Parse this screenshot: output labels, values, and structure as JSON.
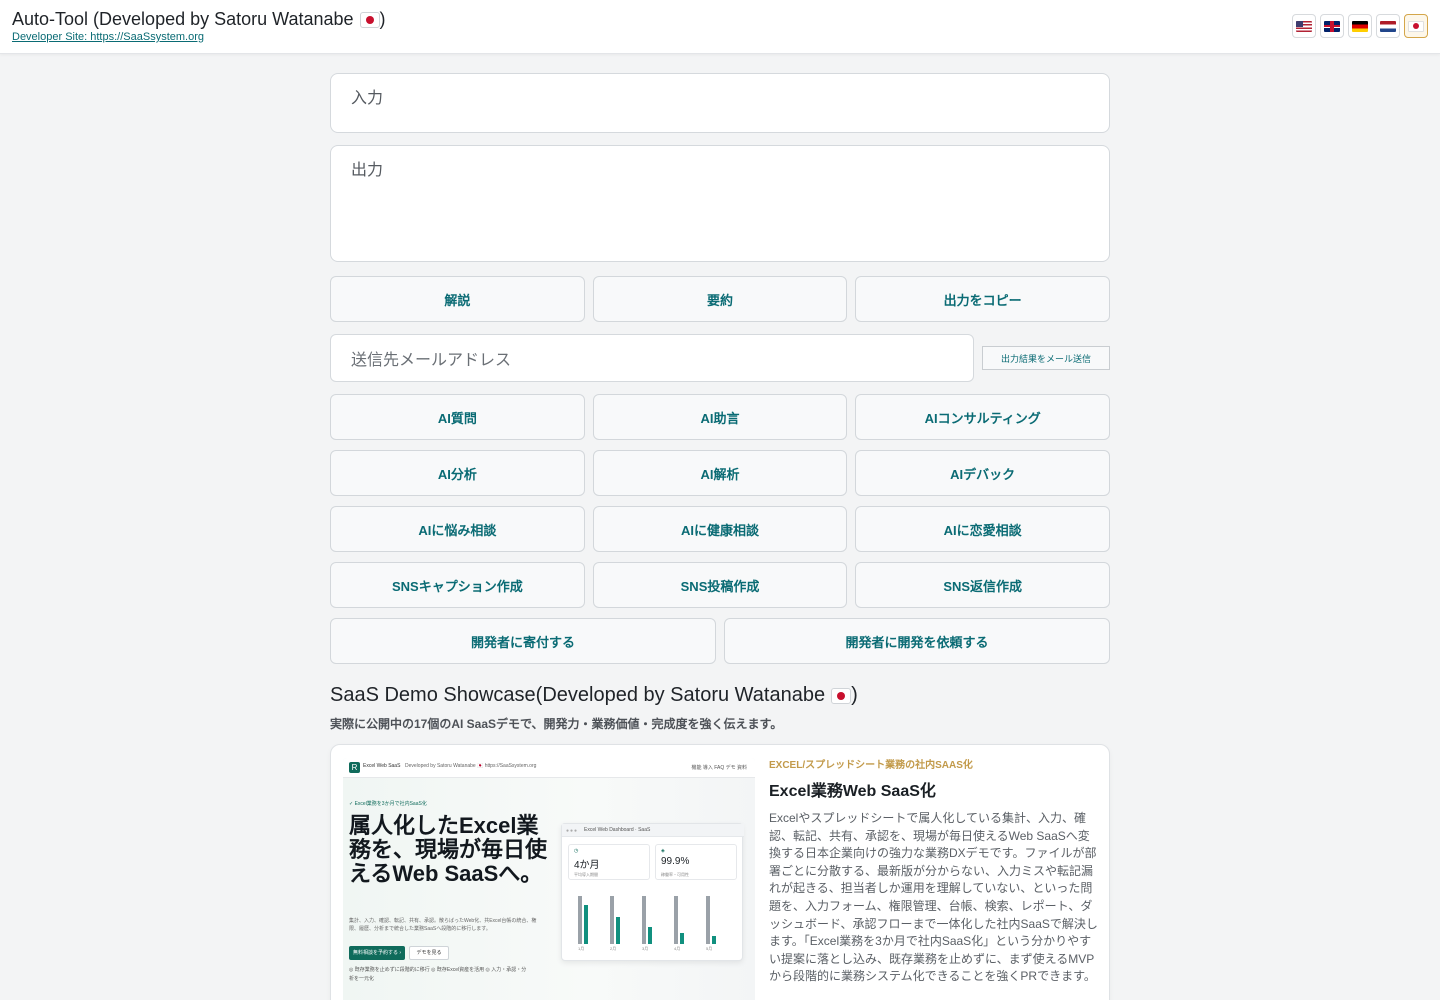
{
  "header": {
    "title": "Auto-Tool (Developed by Satoru Watanabe ",
    "title_suffix": ")",
    "dev_link": "Developer Site: https://SaaSsystem.org",
    "languages": [
      {
        "name": "us-flag-icon",
        "active": false
      },
      {
        "name": "gb-flag-icon",
        "active": false
      },
      {
        "name": "de-flag-icon",
        "active": false
      },
      {
        "name": "nl-flag-icon",
        "active": false
      },
      {
        "name": "jp-flag-icon",
        "active": true
      }
    ]
  },
  "form": {
    "input_placeholder": "入力",
    "output_placeholder": "出力",
    "explain_label": "解説",
    "summary_label": "要約",
    "copy_label": "出力をコピー",
    "email_placeholder": "送信先メールアドレス",
    "send_label": "出力結果をメール送信"
  },
  "ai_buttons": [
    [
      "AI質問",
      "AI助言",
      "AIコンサルティング"
    ],
    [
      "AI分析",
      "AI解析",
      "AIデバック"
    ],
    [
      "AIに悩み相談",
      "AIに健康相談",
      "AIに恋愛相談"
    ],
    [
      "SNSキャプション作成",
      "SNS投稿作成",
      "SNS返信作成"
    ]
  ],
  "donate_label": "開発者に寄付する",
  "request_label": "開発者に開発を依頼する",
  "showcase": {
    "title": "SaaS Demo Showcase(Developed by Satoru Watanabe ",
    "title_suffix": ")",
    "subtitle": "実際に公開中の17個のAI SaaSデモで、開発力・業務価値・完成度を強く伝えます。"
  },
  "card": {
    "category": "EXCEL/スプレッドシート業務の社内SAAS化",
    "title": "Excel業務Web SaaS化",
    "description": "Excelやスプレッドシートで属人化している集計、入力、確認、転記、共有、承認を、現場が毎日使えるWeb SaaSへ変換する日本企業向けの強力な業務DXデモです。ファイルが部署ごとに分散する、最新版が分からない、入力ミスや転記漏れが起きる、担当者しか運用を理解していない、といった問題を、入力フォーム、権限管理、台帳、検索、レポート、ダッシュボード、承認フローまで一体化した社内SaaSで解決します。「Excel業務を3か月で社内SaaS化」という分かりやすい提案に落とし込み、既存業務を止めずに、まず使えるMVPから段階的に業務システム化できることを強くPRできます。",
    "shot": {
      "logo": "R",
      "brand": "Excel Web SaaS",
      "dev": "Developed by Satoru Watanabe 🇯🇵 https://SaaSsystem.org",
      "nav": "機能  導入  FAQ  デモ  資料",
      "tag": "✓ Excel業務を3か月で社内SaaS化",
      "headline": "属人化したExcel業務を、現場が毎日使えるWeb SaaSへ。",
      "body": "集計、入力、確認、転記、共有、承認。散らばったWeb化、共Excel台帳の統合、権限、履歴、分析まで統合した業務SaaSへ段階的に移行します。",
      "cta": "無料相談を予約する ›",
      "cta2": "デモを見る",
      "bullets": "◎ 既存業務を止めずに段階的に移行  ◎ 既存Excel資産を活用\n◎ 入力・承認・分析を一元化",
      "panel_title": "Excel Web Dashboard  ·  SaaS",
      "kpi1_value": "4か月",
      "kpi1_label": "平均導入期間",
      "kpi2_value": "99.9%",
      "kpi2_label": "稼働率・可用性",
      "bars": [
        {
          "label": "1月",
          "a": 0.85,
          "b": 0.7
        },
        {
          "label": "2月",
          "a": 0.85,
          "b": 0.48
        },
        {
          "label": "3月",
          "a": 0.85,
          "b": 0.3
        },
        {
          "label": "4月",
          "a": 0.85,
          "b": 0.2
        },
        {
          "label": "5月",
          "a": 0.85,
          "b": 0.15
        }
      ]
    }
  },
  "colors": {
    "accent": "#0a6b74",
    "brand_green": "#0f6b5b",
    "category_gold": "#c29a4a"
  }
}
